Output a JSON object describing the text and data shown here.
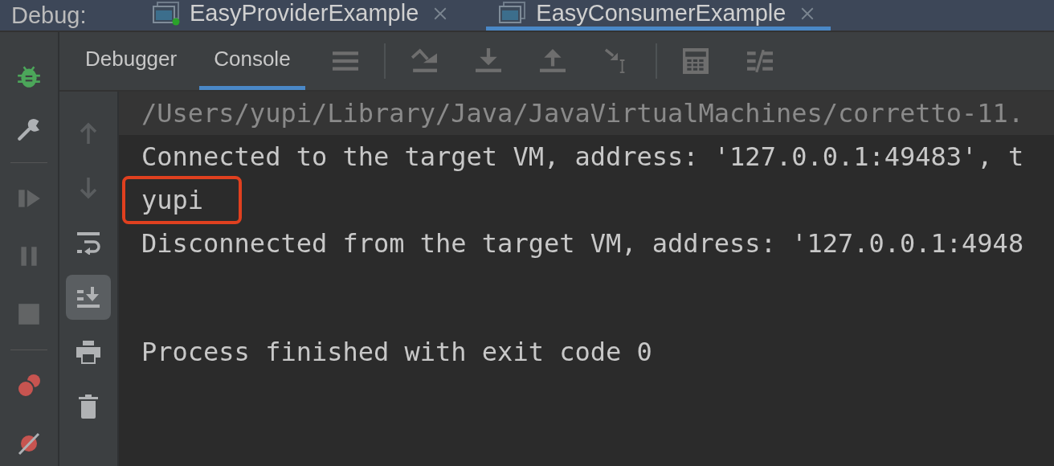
{
  "debug_bar": {
    "label": "Debug:",
    "sessions": [
      {
        "title": "EasyProviderExample",
        "running": true,
        "selected": false
      },
      {
        "title": "EasyConsumerExample",
        "running": false,
        "selected": true
      }
    ]
  },
  "tool_tabs": [
    {
      "label": "Debugger",
      "selected": false
    },
    {
      "label": "Console",
      "selected": true
    }
  ],
  "toolbar": [
    {
      "kind": "layout"
    },
    {
      "kind": "separator"
    },
    {
      "kind": "step-over"
    },
    {
      "kind": "step-into"
    },
    {
      "kind": "step-out"
    },
    {
      "kind": "run-to-cursor"
    },
    {
      "kind": "separator"
    },
    {
      "kind": "evaluate"
    },
    {
      "kind": "trace"
    }
  ],
  "side_toolbar": [
    {
      "kind": "bug",
      "disabled": false
    },
    {
      "kind": "wrench",
      "disabled": false
    },
    {
      "kind": "separator",
      "disabled": false
    },
    {
      "kind": "resume",
      "disabled": true
    },
    {
      "kind": "pause",
      "disabled": true
    },
    {
      "kind": "stop",
      "disabled": true
    },
    {
      "kind": "separator",
      "disabled": false
    },
    {
      "kind": "breakpoints",
      "disabled": false
    },
    {
      "kind": "mute",
      "disabled": false
    }
  ],
  "console_actions": [
    {
      "kind": "up",
      "disabled": true,
      "selected": false
    },
    {
      "kind": "down",
      "disabled": true,
      "selected": false
    },
    {
      "kind": "wrap",
      "disabled": false,
      "selected": false
    },
    {
      "kind": "scroll-end",
      "disabled": false,
      "selected": true
    },
    {
      "kind": "print",
      "disabled": false,
      "selected": false
    },
    {
      "kind": "clear",
      "disabled": false,
      "selected": false
    }
  ],
  "console": [
    {
      "text": "/Users/yupi/Library/Java/JavaVirtualMachines/corretto-11.",
      "kind": "command",
      "outlined": false,
      "blank_before": false
    },
    {
      "text": "Connected to the target VM, address: '127.0.0.1:49483', t",
      "kind": "output",
      "outlined": false,
      "blank_before": false
    },
    {
      "text": "yupi",
      "kind": "output",
      "outlined": true,
      "blank_before": false
    },
    {
      "text": "Disconnected from the target VM, address: '127.0.0.1:4948",
      "kind": "output",
      "outlined": false,
      "blank_before": false
    },
    {
      "text": "Process finished with exit code 0",
      "kind": "output",
      "outlined": false,
      "blank_before": true
    }
  ]
}
